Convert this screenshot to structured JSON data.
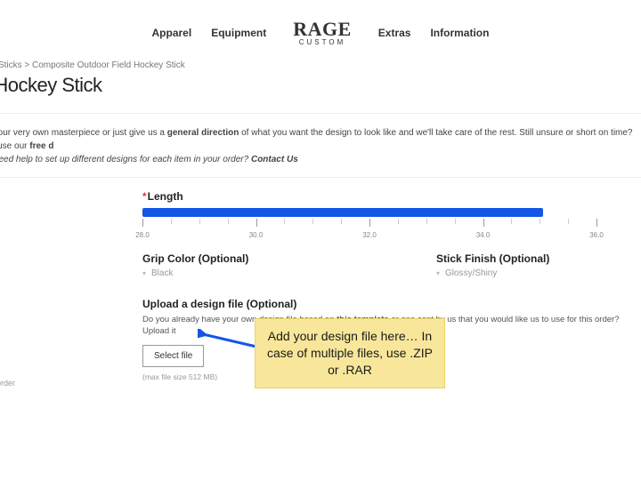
{
  "nav": {
    "apparel": "Apparel",
    "equipment": "Equipment",
    "extras": "Extras",
    "information": "Information",
    "logo_brand": "RAGE",
    "logo_sub": "CUSTOM"
  },
  "breadcrumb": "ey  >  Sticks  >  Composite Outdoor Field Hockey Stick",
  "page_title": "d Hockey Stick",
  "intro": {
    "line1a": "ate your very own masterpiece or just give us a ",
    "line1b": "general direction",
    "line1c": " of what you want the design to look like and we'll take care of the rest. Still unsure or short on time? Just use our ",
    "line1d": "free d",
    "line2a": "  Need help to set up different designs for each item in your order? ",
    "line2b": "Contact Us"
  },
  "length": {
    "label": "Length",
    "ticks": [
      "28.0",
      "30.0",
      "32.0",
      "34.0",
      "36.0"
    ],
    "minor_interval": "0.5"
  },
  "grip": {
    "label": "Grip Color (Optional)",
    "value": "Black"
  },
  "finish": {
    "label": "Stick Finish (Optional)",
    "value": "Glossy/Shiny"
  },
  "upload": {
    "label": "Upload a design file (Optional)",
    "desc_a": "Do you already have your own design file based on ",
    "desc_b": "this template",
    "desc_c": " or one sent by us that you would like us to use for this order? Upload it",
    "button": "Select file",
    "maxsize": "(max file size 512 MB)"
  },
  "sidebar_hint": "your order",
  "callout": "Add your design file here… In case of multiple files, use .ZIP or .RAR"
}
